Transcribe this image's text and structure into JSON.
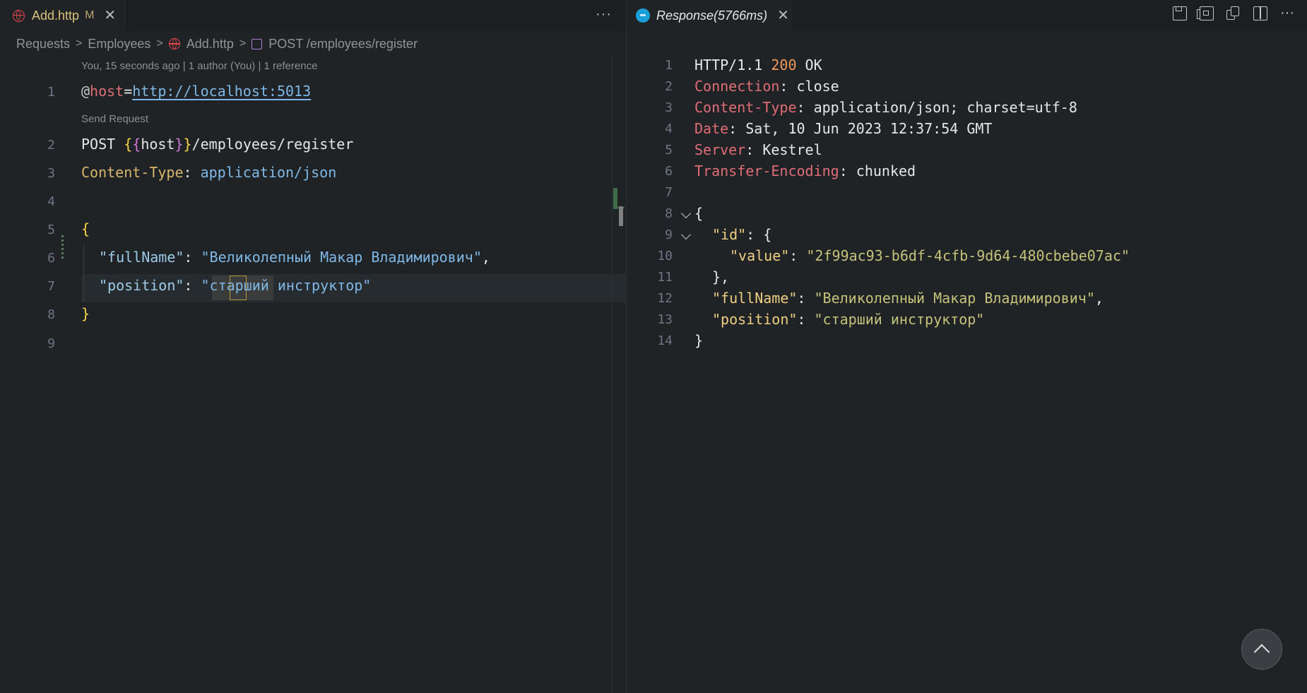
{
  "editor": {
    "tab": {
      "label": "Add.http",
      "modified": "M",
      "close": "✕",
      "icon": "globe-icon"
    },
    "more": "···",
    "breadcrumb": [
      "Requests",
      "Employees",
      "Add.http",
      "POST /employees/register"
    ],
    "codelens_blame": "You, 15 seconds ago | 1 author (You) | 1 reference",
    "codelens_send": "Send Request",
    "lines": {
      "n1": "1",
      "n2": "2",
      "n3": "3",
      "n4": "4",
      "n5": "5",
      "n6": "6",
      "n7": "7",
      "n8": "8",
      "n9": "9",
      "l1_at": "@",
      "l1_var": "host",
      "l1_eq": "=",
      "l1_url": "http://localhost:5013",
      "l2_method": "POST ",
      "l2_b1": "{",
      "l2_b2": "{",
      "l2_var": "host",
      "l2_b3": "}",
      "l2_b4": "}",
      "l2_path": "/employees/register",
      "l3_key": "Content-Type",
      "l3_colon": ": ",
      "l3_val": "application/json",
      "l5": "{",
      "l6_key": "\"fullName\"",
      "l6_colon": ": ",
      "l6_val": "\"Великолепный Макар Владимирович\"",
      "l6_comma": ",",
      "l7_key": "\"position\"",
      "l7_colon": ": ",
      "l7_val": "\"старший инструктор\"",
      "l8": "}"
    }
  },
  "response": {
    "tab": {
      "label": "Response(5766ms)",
      "close": "✕",
      "icon": "response-icon"
    },
    "toolbar": [
      "save-icon",
      "save-body-icon",
      "copy-icon",
      "split-editor-icon",
      "more-icon"
    ],
    "more": "···",
    "lines": {
      "n1": "1",
      "n2": "2",
      "n3": "3",
      "n4": "4",
      "n5": "5",
      "n6": "6",
      "n7": "7",
      "n8": "8",
      "n9": "9",
      "n10": "10",
      "n11": "11",
      "n12": "12",
      "n13": "13",
      "n14": "14",
      "l1_a": "HTTP/1.1 ",
      "l1_code": "200",
      "l1_b": " OK",
      "l2_k": "Connection",
      "l2_v": ": close",
      "l3_k": "Content-Type",
      "l3_v": ": application/json; charset=utf-8",
      "l4_k": "Date",
      "l4_v": ": Sat, 10 Jun 2023 12:37:54 GMT",
      "l5_k": "Server",
      "l5_v": ": Kestrel",
      "l6_k": "Transfer-Encoding",
      "l6_v": ": chunked",
      "l8": "{",
      "l9_k": "\"id\"",
      "l9_v": ": {",
      "l10_k": "\"value\"",
      "l10_c": ": ",
      "l10_v": "\"2f99ac93-b6df-4cfb-9d64-480cbebe07ac\"",
      "l11": "},",
      "l12_k": "\"fullName\"",
      "l12_c": ": ",
      "l12_v": "\"Великолепный Макар Владимирович\"",
      "l12_comma": ",",
      "l13_k": "\"position\"",
      "l13_c": ": ",
      "l13_v": "\"старший инструктор\"",
      "l14": "}"
    }
  },
  "colors": {
    "background": "#1f2326",
    "http_var": "#e06c75",
    "json_key": "#f0cf83",
    "json_string": "#c5c27a",
    "status_code": "#ef9a5a"
  }
}
